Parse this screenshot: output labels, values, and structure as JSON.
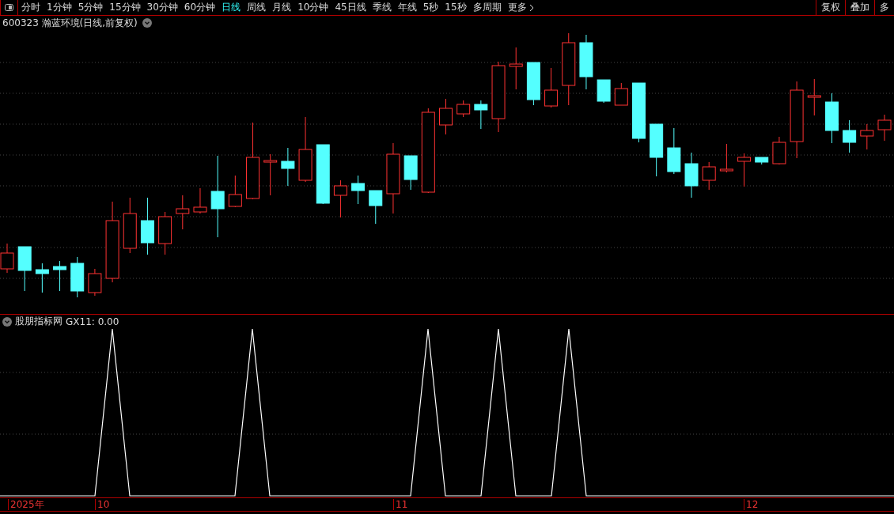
{
  "toolbar": {
    "periods": [
      {
        "label": "分时",
        "selected": false
      },
      {
        "label": "1分钟",
        "selected": false
      },
      {
        "label": "5分钟",
        "selected": false
      },
      {
        "label": "15分钟",
        "selected": false
      },
      {
        "label": "30分钟",
        "selected": false
      },
      {
        "label": "60分钟",
        "selected": false
      },
      {
        "label": "日线",
        "selected": true
      },
      {
        "label": "周线",
        "selected": false
      },
      {
        "label": "月线",
        "selected": false
      },
      {
        "label": "10分钟",
        "selected": false
      },
      {
        "label": "45日线",
        "selected": false
      },
      {
        "label": "季线",
        "selected": false
      },
      {
        "label": "年线",
        "selected": false
      },
      {
        "label": "5秒",
        "selected": false
      },
      {
        "label": "15秒",
        "selected": false
      },
      {
        "label": "多周期",
        "selected": false
      }
    ],
    "more": "更多",
    "right_buttons": [
      "复权",
      "叠加",
      "多"
    ]
  },
  "chart_title": "600323 瀚蓝环境(日线,前复权)",
  "indicator": {
    "name": "股朋指标网",
    "reading": "GX11: 0.00"
  },
  "time_axis": [
    {
      "label": "2025年",
      "kind": "year"
    },
    {
      "label": "10",
      "kind": "month"
    },
    {
      "label": "11",
      "kind": "month"
    },
    {
      "label": "12",
      "kind": "month"
    }
  ]
}
